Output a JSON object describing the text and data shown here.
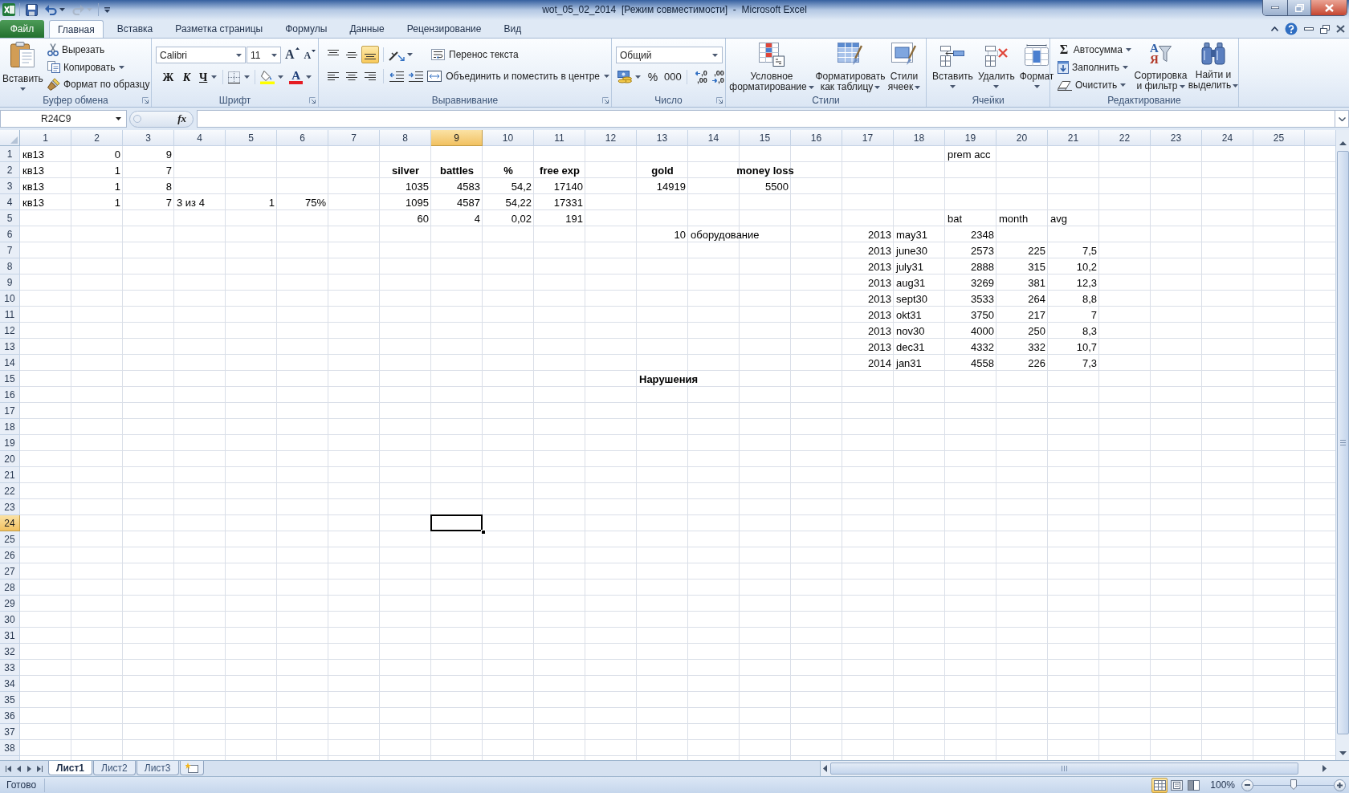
{
  "window": {
    "title": "wot_05_02_2014  [Режим совместимости]  -  Microsoft Excel"
  },
  "quick_access": [
    {
      "kind": "save",
      "disabled": false
    },
    {
      "kind": "undo",
      "disabled": false
    },
    {
      "kind": "redo",
      "disabled": true
    }
  ],
  "ribbon_tabs": [
    {
      "label": "Файл",
      "kind": "file",
      "selected": false
    },
    {
      "label": "Главная",
      "kind": "tab",
      "selected": true
    },
    {
      "label": "Вставка",
      "kind": "tab",
      "selected": false
    },
    {
      "label": "Разметка страницы",
      "kind": "tab",
      "selected": false
    },
    {
      "label": "Формулы",
      "kind": "tab",
      "selected": false
    },
    {
      "label": "Данные",
      "kind": "tab",
      "selected": false
    },
    {
      "label": "Рецензирование",
      "kind": "tab",
      "selected": false
    },
    {
      "label": "Вид",
      "kind": "tab",
      "selected": false
    }
  ],
  "clipboard": {
    "label": "Буфер обмена",
    "paste": "Вставить",
    "actions": [
      {
        "kind": "cut",
        "label": "Вырезать"
      },
      {
        "kind": "copy",
        "label": "Копировать"
      },
      {
        "kind": "format_painter",
        "label": "Формат по образцу"
      }
    ]
  },
  "font": {
    "label": "Шрифт",
    "name": "Calibri",
    "size": "11",
    "grow": "A",
    "shrink": "A",
    "bold": "Ж",
    "italic": "К",
    "underline": "Ч",
    "font_color": "A"
  },
  "alignment": {
    "label": "Выравнивание",
    "vertical": [
      {
        "kind": "top",
        "selected": false
      },
      {
        "kind": "middle",
        "selected": false
      },
      {
        "kind": "bottom",
        "selected": true
      }
    ],
    "horizontal": [
      {
        "kind": "left",
        "selected": false
      },
      {
        "kind": "center",
        "selected": false
      },
      {
        "kind": "right",
        "selected": false
      }
    ],
    "wrap_text": "Перенос текста",
    "merge": "Объединить и поместить в центре"
  },
  "number": {
    "label": "Число",
    "format": "Общий",
    "percent": "%",
    "thousands": "000",
    "decimals": [
      {
        "kind": "increase",
        "top": ",0",
        "bottom": ",00"
      },
      {
        "kind": "decrease",
        "top": ",00",
        "bottom": ",0"
      }
    ]
  },
  "styles": {
    "label": "Стили",
    "buttons": [
      {
        "kind": "conditional",
        "lines": [
          "Условное",
          "форматирование"
        ]
      },
      {
        "kind": "table",
        "lines": [
          "Форматировать",
          "как таблицу"
        ]
      },
      {
        "kind": "cell_styles",
        "lines": [
          "Стили",
          "ячеек"
        ]
      }
    ]
  },
  "cells": {
    "label": "Ячейки",
    "buttons": [
      {
        "kind": "insert",
        "label": "Вставить"
      },
      {
        "kind": "delete",
        "label": "Удалить"
      },
      {
        "kind": "format",
        "label": "Формат"
      }
    ]
  },
  "editing": {
    "label": "Редактирование",
    "actions": [
      {
        "kind": "autosum",
        "symbol": "Σ",
        "label": "Автосумма"
      },
      {
        "kind": "fill",
        "label": "Заполнить"
      },
      {
        "kind": "clear",
        "label": "Очистить"
      }
    ],
    "buttons": [
      {
        "kind": "sort",
        "letters": [
          "A",
          "Я"
        ],
        "lines": [
          "Сортировка",
          "и фильтр"
        ]
      },
      {
        "kind": "find",
        "lines": [
          "Найти и",
          "выделить"
        ]
      }
    ]
  },
  "formula_bar": {
    "name_box": "R24C9",
    "function_label": "fx"
  },
  "sheet": {
    "columns": [
      {
        "label": "1",
        "selected": false
      },
      {
        "label": "2",
        "selected": false
      },
      {
        "label": "3",
        "selected": false
      },
      {
        "label": "4",
        "selected": false
      },
      {
        "label": "5",
        "selected": false
      },
      {
        "label": "6",
        "selected": false
      },
      {
        "label": "7",
        "selected": false
      },
      {
        "label": "8",
        "selected": false
      },
      {
        "label": "9",
        "selected": true
      },
      {
        "label": "10",
        "selected": false
      },
      {
        "label": "11",
        "selected": false
      },
      {
        "label": "12",
        "selected": false
      },
      {
        "label": "13",
        "selected": false
      },
      {
        "label": "14",
        "selected": false
      },
      {
        "label": "15",
        "selected": false
      },
      {
        "label": "16",
        "selected": false
      },
      {
        "label": "17",
        "selected": false
      },
      {
        "label": "18",
        "selected": false
      },
      {
        "label": "19",
        "selected": false
      },
      {
        "label": "20",
        "selected": false
      },
      {
        "label": "21",
        "selected": false
      },
      {
        "label": "22",
        "selected": false
      },
      {
        "label": "23",
        "selected": false
      },
      {
        "label": "24",
        "selected": false
      },
      {
        "label": "25",
        "selected": false
      }
    ],
    "rows": [
      {
        "label": "1",
        "selected": false,
        "cells": [
          {
            "text": "кв13",
            "kind": "text"
          },
          {
            "text": "0",
            "kind": "number"
          },
          {
            "text": "9",
            "kind": "number"
          },
          null,
          null,
          null,
          null,
          null,
          null,
          null,
          null,
          null,
          null,
          null,
          null,
          null,
          null,
          null,
          {
            "text": "prem acc",
            "kind": "text"
          }
        ]
      },
      {
        "label": "2",
        "selected": false,
        "cells": [
          {
            "text": "кв13",
            "kind": "text"
          },
          {
            "text": "1",
            "kind": "number"
          },
          {
            "text": "7",
            "kind": "number"
          },
          null,
          null,
          null,
          null,
          {
            "text": "silver",
            "kind": "header",
            "bold": true
          },
          {
            "text": "battles",
            "kind": "header",
            "bold": true
          },
          {
            "text": "%",
            "kind": "header",
            "bold": true
          },
          {
            "text": "free exp",
            "kind": "header",
            "bold": true
          },
          null,
          {
            "text": "gold",
            "kind": "header",
            "bold": true
          },
          null,
          {
            "text": "money loss",
            "kind": "header",
            "bold": true
          }
        ]
      },
      {
        "label": "3",
        "selected": false,
        "cells": [
          {
            "text": "кв13",
            "kind": "text"
          },
          {
            "text": "1",
            "kind": "number"
          },
          {
            "text": "8",
            "kind": "number"
          },
          null,
          null,
          null,
          null,
          {
            "text": "1035",
            "kind": "number"
          },
          {
            "text": "4583",
            "kind": "number"
          },
          {
            "text": "54,2",
            "kind": "number"
          },
          {
            "text": "17140",
            "kind": "number"
          },
          null,
          {
            "text": "14919",
            "kind": "number"
          },
          null,
          {
            "text": "5500",
            "kind": "number"
          }
        ]
      },
      {
        "label": "4",
        "selected": false,
        "cells": [
          {
            "text": "кв13",
            "kind": "text"
          },
          {
            "text": "1",
            "kind": "number"
          },
          {
            "text": "7",
            "kind": "number"
          },
          {
            "text": "3 из 4",
            "kind": "text"
          },
          {
            "text": "1",
            "kind": "number"
          },
          {
            "text": "75%",
            "kind": "number"
          },
          null,
          {
            "text": "1095",
            "kind": "number"
          },
          {
            "text": "4587",
            "kind": "number"
          },
          {
            "text": "54,22",
            "kind": "number"
          },
          {
            "text": "17331",
            "kind": "number"
          }
        ]
      },
      {
        "label": "5",
        "selected": false,
        "cells": [
          null,
          null,
          null,
          null,
          null,
          null,
          null,
          {
            "text": "60",
            "kind": "number"
          },
          {
            "text": "4",
            "kind": "number"
          },
          {
            "text": "0,02",
            "kind": "number"
          },
          {
            "text": "191",
            "kind": "number"
          },
          null,
          null,
          null,
          null,
          null,
          null,
          null,
          {
            "text": "bat",
            "kind": "text"
          },
          {
            "text": "month",
            "kind": "text"
          },
          {
            "text": "avg",
            "kind": "text"
          }
        ]
      },
      {
        "label": "6",
        "selected": false,
        "cells": [
          null,
          null,
          null,
          null,
          null,
          null,
          null,
          null,
          null,
          null,
          null,
          null,
          {
            "text": "10",
            "kind": "number"
          },
          {
            "text": "оборудование",
            "kind": "text"
          },
          null,
          null,
          {
            "text": "2013",
            "kind": "number"
          },
          {
            "text": "may31",
            "kind": "text"
          },
          {
            "text": "2348",
            "kind": "number"
          }
        ]
      },
      {
        "label": "7",
        "selected": false,
        "cells": [
          null,
          null,
          null,
          null,
          null,
          null,
          null,
          null,
          null,
          null,
          null,
          null,
          null,
          null,
          null,
          null,
          {
            "text": "2013",
            "kind": "number"
          },
          {
            "text": "june30",
            "kind": "text"
          },
          {
            "text": "2573",
            "kind": "number"
          },
          {
            "text": "225",
            "kind": "number"
          },
          {
            "text": "7,5",
            "kind": "number"
          }
        ]
      },
      {
        "label": "8",
        "selected": false,
        "cells": [
          null,
          null,
          null,
          null,
          null,
          null,
          null,
          null,
          null,
          null,
          null,
          null,
          null,
          null,
          null,
          null,
          {
            "text": "2013",
            "kind": "number"
          },
          {
            "text": "july31",
            "kind": "text"
          },
          {
            "text": "2888",
            "kind": "number"
          },
          {
            "text": "315",
            "kind": "number"
          },
          {
            "text": "10,2",
            "kind": "number"
          }
        ]
      },
      {
        "label": "9",
        "selected": false,
        "cells": [
          null,
          null,
          null,
          null,
          null,
          null,
          null,
          null,
          null,
          null,
          null,
          null,
          null,
          null,
          null,
          null,
          {
            "text": "2013",
            "kind": "number"
          },
          {
            "text": "aug31",
            "kind": "text"
          },
          {
            "text": "3269",
            "kind": "number"
          },
          {
            "text": "381",
            "kind": "number"
          },
          {
            "text": "12,3",
            "kind": "number"
          }
        ]
      },
      {
        "label": "10",
        "selected": false,
        "cells": [
          null,
          null,
          null,
          null,
          null,
          null,
          null,
          null,
          null,
          null,
          null,
          null,
          null,
          null,
          null,
          null,
          {
            "text": "2013",
            "kind": "number"
          },
          {
            "text": "sept30",
            "kind": "text"
          },
          {
            "text": "3533",
            "kind": "number"
          },
          {
            "text": "264",
            "kind": "number"
          },
          {
            "text": "8,8",
            "kind": "number"
          }
        ]
      },
      {
        "label": "11",
        "selected": false,
        "cells": [
          null,
          null,
          null,
          null,
          null,
          null,
          null,
          null,
          null,
          null,
          null,
          null,
          null,
          null,
          null,
          null,
          {
            "text": "2013",
            "kind": "number"
          },
          {
            "text": "okt31",
            "kind": "text"
          },
          {
            "text": "3750",
            "kind": "number"
          },
          {
            "text": "217",
            "kind": "number"
          },
          {
            "text": "7",
            "kind": "number"
          }
        ]
      },
      {
        "label": "12",
        "selected": false,
        "cells": [
          null,
          null,
          null,
          null,
          null,
          null,
          null,
          null,
          null,
          null,
          null,
          null,
          null,
          null,
          null,
          null,
          {
            "text": "2013",
            "kind": "number"
          },
          {
            "text": "nov30",
            "kind": "text"
          },
          {
            "text": "4000",
            "kind": "number"
          },
          {
            "text": "250",
            "kind": "number"
          },
          {
            "text": "8,3",
            "kind": "number"
          }
        ]
      },
      {
        "label": "13",
        "selected": false,
        "cells": [
          null,
          null,
          null,
          null,
          null,
          null,
          null,
          null,
          null,
          null,
          null,
          null,
          null,
          null,
          null,
          null,
          {
            "text": "2013",
            "kind": "number"
          },
          {
            "text": "dec31",
            "kind": "text"
          },
          {
            "text": "4332",
            "kind": "number"
          },
          {
            "text": "332",
            "kind": "number"
          },
          {
            "text": "10,7",
            "kind": "number"
          }
        ]
      },
      {
        "label": "14",
        "selected": false,
        "cells": [
          null,
          null,
          null,
          null,
          null,
          null,
          null,
          null,
          null,
          null,
          null,
          null,
          null,
          null,
          null,
          null,
          {
            "text": "2014",
            "kind": "number"
          },
          {
            "text": "jan31",
            "kind": "text"
          },
          {
            "text": "4558",
            "kind": "number"
          },
          {
            "text": "226",
            "kind": "number"
          },
          {
            "text": "7,3",
            "kind": "number"
          }
        ]
      },
      {
        "label": "15",
        "selected": false,
        "cells": [
          null,
          null,
          null,
          null,
          null,
          null,
          null,
          null,
          null,
          null,
          null,
          null,
          {
            "text": "Нарушения",
            "kind": "text",
            "bold": true
          }
        ]
      },
      {
        "label": "16",
        "selected": false
      },
      {
        "label": "17",
        "selected": false
      },
      {
        "label": "18",
        "selected": false
      },
      {
        "label": "19",
        "selected": false
      },
      {
        "label": "20",
        "selected": false
      },
      {
        "label": "21",
        "selected": false
      },
      {
        "label": "22",
        "selected": false
      },
      {
        "label": "23",
        "selected": false
      },
      {
        "label": "24",
        "selected": true
      },
      {
        "label": "25",
        "selected": false
      },
      {
        "label": "26",
        "selected": false
      },
      {
        "label": "27",
        "selected": false
      },
      {
        "label": "28",
        "selected": false
      },
      {
        "label": "29",
        "selected": false
      },
      {
        "label": "30",
        "selected": false
      },
      {
        "label": "31",
        "selected": false
      },
      {
        "label": "32",
        "selected": false
      },
      {
        "label": "33",
        "selected": false
      },
      {
        "label": "34",
        "selected": false
      },
      {
        "label": "35",
        "selected": false
      },
      {
        "label": "36",
        "selected": false
      },
      {
        "label": "37",
        "selected": false
      },
      {
        "label": "38",
        "selected": false
      }
    ]
  },
  "sheet_tabs": [
    {
      "label": "Лист1",
      "selected": true
    },
    {
      "label": "Лист2",
      "selected": false
    },
    {
      "label": "Лист3",
      "selected": false
    }
  ],
  "status_bar": {
    "status": "Готово",
    "views": [
      {
        "kind": "normal",
        "selected": true
      },
      {
        "kind": "page_layout",
        "selected": false
      },
      {
        "kind": "page_break",
        "selected": false
      }
    ],
    "zoom": "100%",
    "zoom_slider": {
      "level": 0.5
    }
  }
}
